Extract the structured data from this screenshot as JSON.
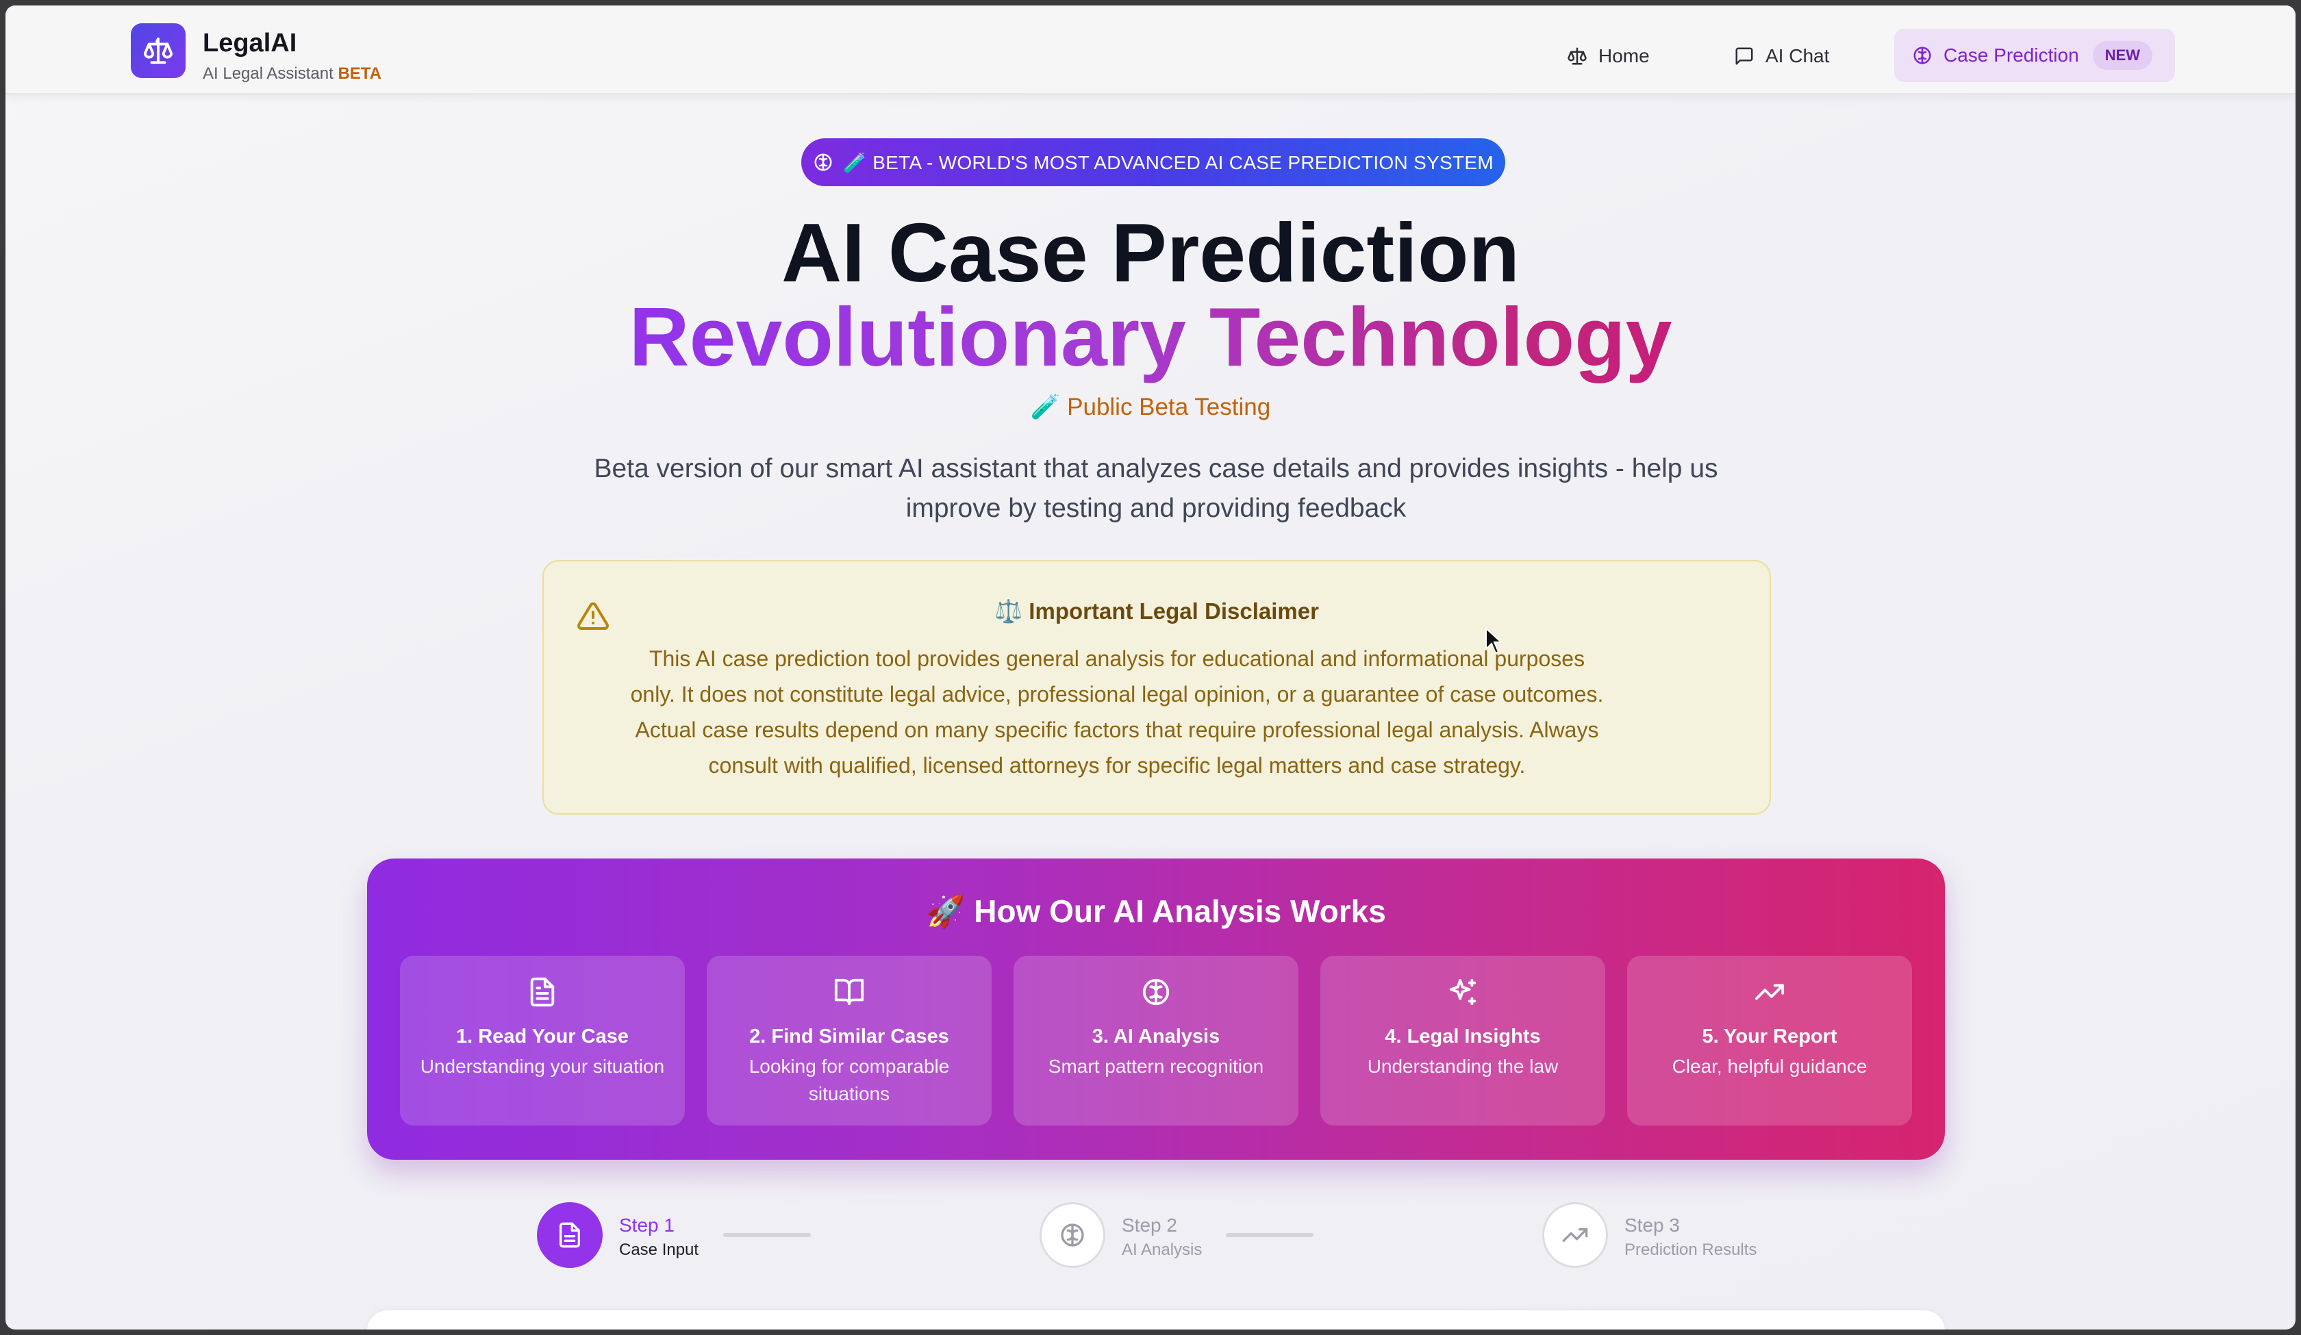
{
  "navbar": {
    "brand_name": "LegalAI",
    "brand_sub": "AI Legal Assistant",
    "brand_beta": "BETA",
    "nav": [
      {
        "label": "Home",
        "icon": "scale-icon"
      },
      {
        "label": "AI Chat",
        "icon": "chat-icon"
      },
      {
        "label": "Case Prediction",
        "icon": "brain-icon",
        "badge": "NEW",
        "active": true
      }
    ]
  },
  "hero": {
    "pill": "🧪 BETA - WORLD'S MOST ADVANCED AI CASE PREDICTION SYSTEM",
    "title_line1": "AI Case Prediction",
    "title_line2": "Revolutionary Technology",
    "public_beta": "🧪 Public Beta Testing",
    "description": "Beta version of our smart AI assistant that analyzes case details and provides insights - help us improve by testing and providing feedback"
  },
  "disclaimer": {
    "title": "⚖️ Important Legal Disclaimer",
    "body": "This AI case prediction tool provides general analysis for educational and informational purposes only. It does not constitute legal advice, professional legal opinion, or a guarantee of case outcomes. Actual case results depend on many specific factors that require professional legal analysis. Always consult with qualified, licensed attorneys for specific legal matters and case strategy."
  },
  "how_it_works": {
    "title": "🚀 How Our AI Analysis Works",
    "steps": [
      {
        "title": "1. Read Your Case",
        "desc": "Understanding your situation",
        "icon": "document-icon"
      },
      {
        "title": "2. Find Similar Cases",
        "desc": "Looking for comparable situations",
        "icon": "book-icon"
      },
      {
        "title": "3. AI Analysis",
        "desc": "Smart pattern recognition",
        "icon": "brain-icon"
      },
      {
        "title": "4. Legal Insights",
        "desc": "Understanding the law",
        "icon": "sparkles-icon"
      },
      {
        "title": "5. Your Report",
        "desc": "Clear, helpful guidance",
        "icon": "trending-up-icon"
      }
    ]
  },
  "progress": [
    {
      "label": "Step 1",
      "sub": "Case Input",
      "active": true
    },
    {
      "label": "Step 2",
      "sub": "AI Analysis",
      "active": false
    },
    {
      "label": "Step 3",
      "sub": "Prediction Results",
      "active": false
    }
  ],
  "colors": {
    "accent_purple": "#9333ea",
    "accent_pink": "#d6246e",
    "beta_orange": "#c2620a",
    "disclaimer_bg": "#f4f1dc"
  }
}
